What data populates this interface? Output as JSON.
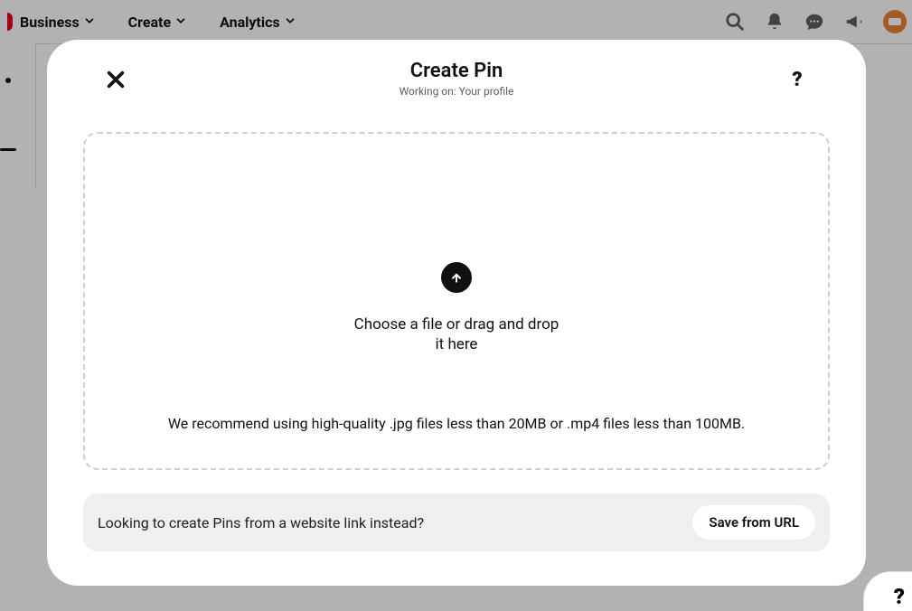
{
  "header": {
    "nav": [
      {
        "label": "Business"
      },
      {
        "label": "Create"
      },
      {
        "label": "Analytics"
      }
    ],
    "icons": {
      "search": "search-icon",
      "bell": "bell-icon",
      "chat": "chat-icon",
      "announce": "megaphone-icon"
    }
  },
  "modal": {
    "title": "Create Pin",
    "subtitle": "Working on: Your profile",
    "dropzone": {
      "message_line1": "Choose a file or drag and drop",
      "message_line2": "it here",
      "recommendation": "We recommend using high-quality .jpg files less than 20MB or .mp4 files less than 100MB."
    },
    "urlbar": {
      "prompt": "Looking to create Pins from a website link instead?",
      "button": "Save from URL"
    }
  },
  "page_help_label": "?",
  "modal_help_label": "?"
}
